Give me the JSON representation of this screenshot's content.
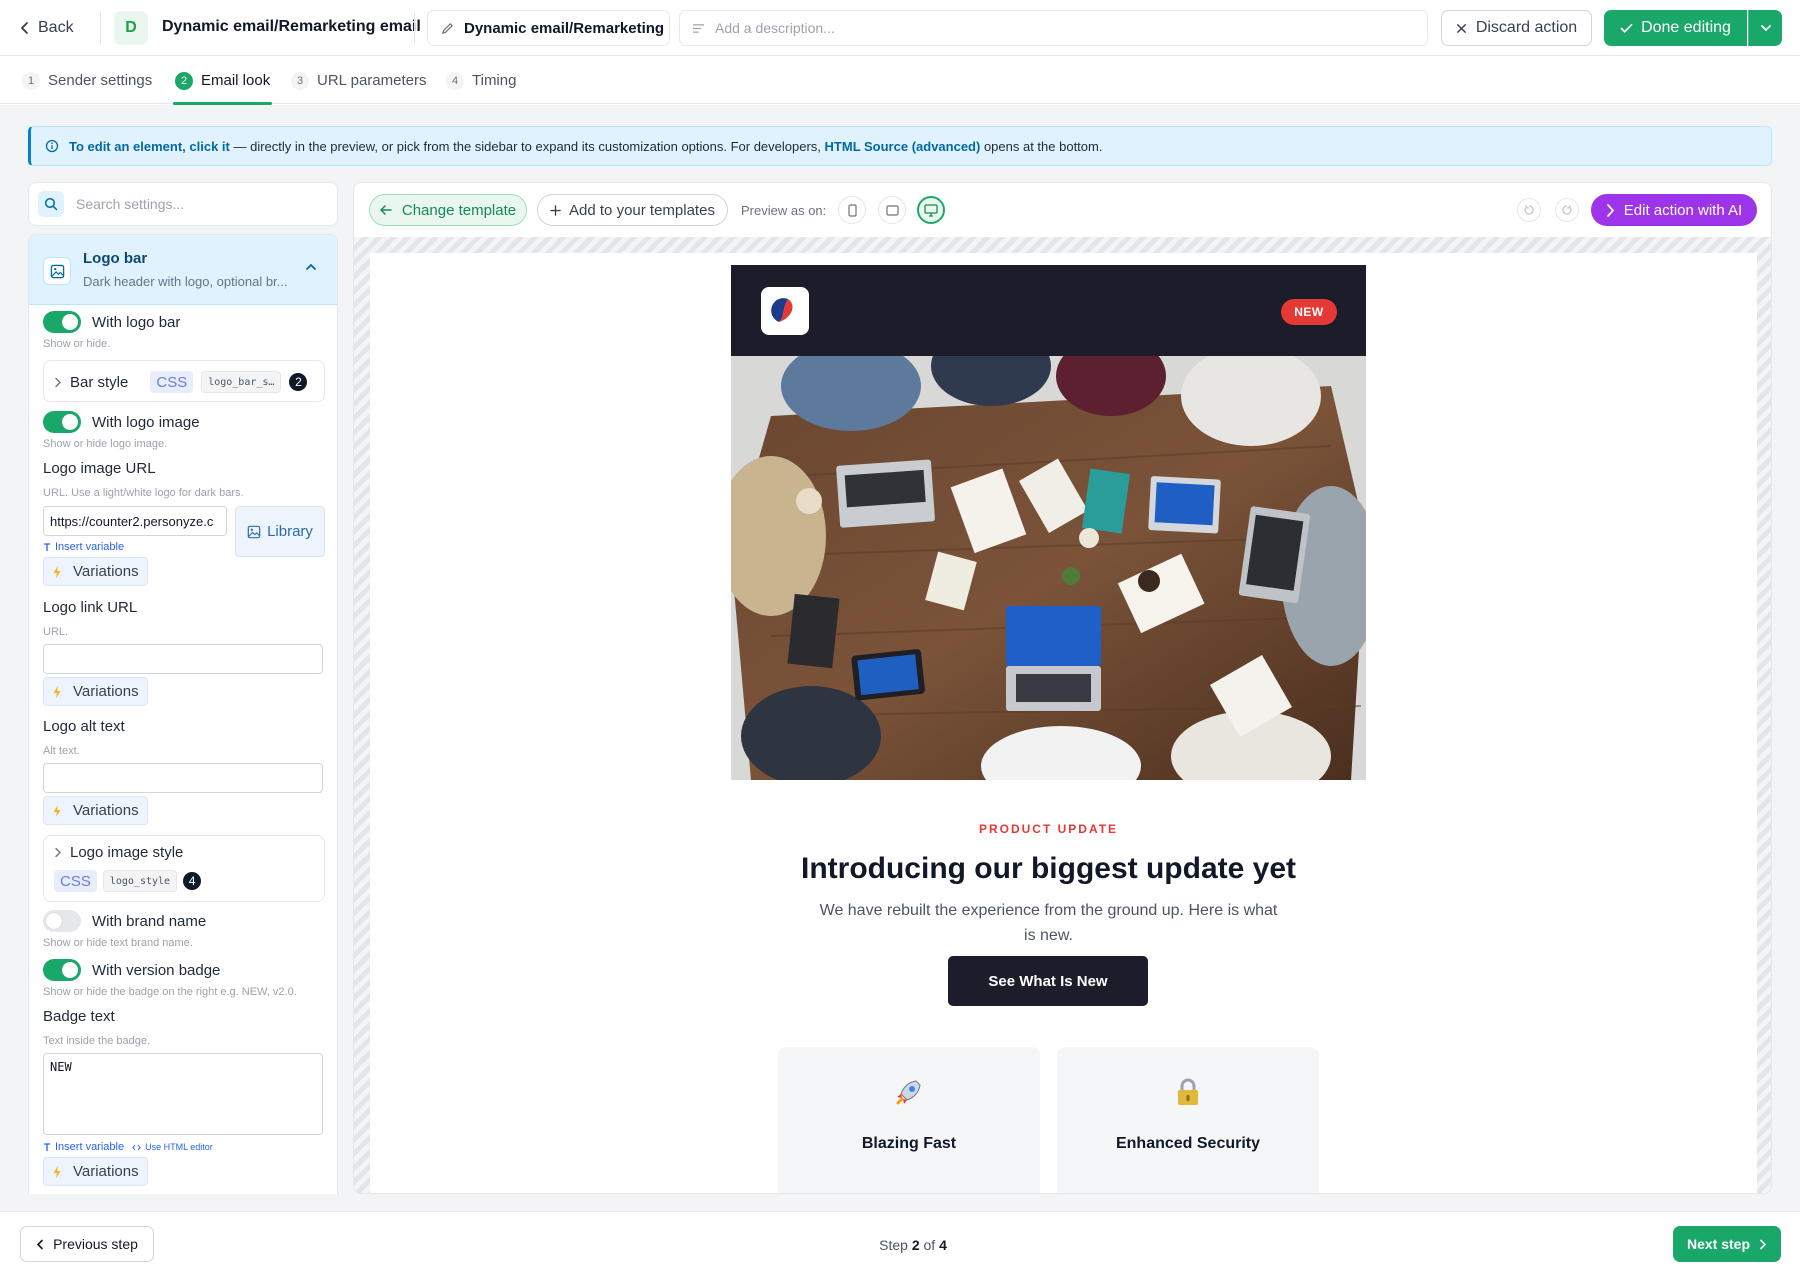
{
  "header": {
    "back_label": "Back",
    "avatar_letter": "D",
    "action_title": "Dynamic email/Remarketing email",
    "name_value": "Dynamic email/Remarketing",
    "description_placeholder": "Add a description...",
    "discard_label": "Discard action",
    "done_label": "Done editing"
  },
  "tabs": [
    {
      "num": "1",
      "label": "Sender settings"
    },
    {
      "num": "2",
      "label": "Email look",
      "active": true
    },
    {
      "num": "3",
      "label": "URL parameters"
    },
    {
      "num": "4",
      "label": "Timing"
    }
  ],
  "banner": {
    "strong": "To edit an element, click it",
    "text": " — directly in the preview, or pick from the sidebar to expand its customization options. For developers, ",
    "link": "HTML Source (advanced)",
    "tail": " opens at the bottom."
  },
  "sidebar": {
    "search_placeholder": "Search settings...",
    "section_title": "Logo bar",
    "section_subtitle": "Dark header with logo, optional br...",
    "with_logo_bar": {
      "label": "With logo bar",
      "hint": "Show or hide.",
      "on": true
    },
    "bar_style": {
      "label": "Bar style",
      "css": "CSS",
      "code": "logo_bar_s…",
      "count": "2"
    },
    "with_logo_image": {
      "label": "With logo image",
      "hint": "Show or hide logo image.",
      "on": true
    },
    "logo_image_url": {
      "label": "Logo image URL",
      "hint": "URL. Use a light/white logo for dark bars.",
      "value": "https://counter2.personyze.c",
      "library": "Library",
      "insert_variable": "Insert variable"
    },
    "variations_label": "Variations",
    "logo_link_url": {
      "label": "Logo link URL",
      "hint": "URL.",
      "value": ""
    },
    "logo_alt_text": {
      "label": "Logo alt text",
      "hint": "Alt text.",
      "value": ""
    },
    "logo_image_style": {
      "label": "Logo image style",
      "css": "CSS",
      "code": "logo_style",
      "count": "4"
    },
    "with_brand_name": {
      "label": "With brand name",
      "hint": "Show or hide text brand name.",
      "on": false
    },
    "with_version_badge": {
      "label": "With version badge",
      "hint": "Show or hide the badge on the right e.g. NEW, v2.0.",
      "on": true
    },
    "badge_text": {
      "label": "Badge text",
      "hint": "Text inside the badge.",
      "value": "NEW",
      "insert_variable": "Insert variable",
      "html_editor": "Use HTML editor"
    }
  },
  "preview": {
    "change_template": "Change template",
    "add_template": "Add to your templates",
    "preview_as": "Preview as on:",
    "edit_ai": "Edit action with AI",
    "active_device": "desktop"
  },
  "email": {
    "badge": "NEW",
    "eyebrow": "PRODUCT UPDATE",
    "title": "Introducing our biggest update yet",
    "body": "We have rebuilt the experience from the ground up. Here is what is new.",
    "cta": "See What Is New",
    "features": [
      {
        "icon": "rocket-icon",
        "title": "Blazing Fast"
      },
      {
        "icon": "lock-icon",
        "title": "Enhanced Security"
      }
    ]
  },
  "footer": {
    "prev_label": "Previous step",
    "step_word": "Step",
    "step_current": "2",
    "step_of": "of",
    "step_total": "4",
    "next_label": "Next step"
  },
  "colors": {
    "accent": "#1aa86a",
    "ai": "#9d34ea",
    "info": "#0369a1",
    "badge": "#e53935",
    "email_dark": "#1c1c2b"
  }
}
